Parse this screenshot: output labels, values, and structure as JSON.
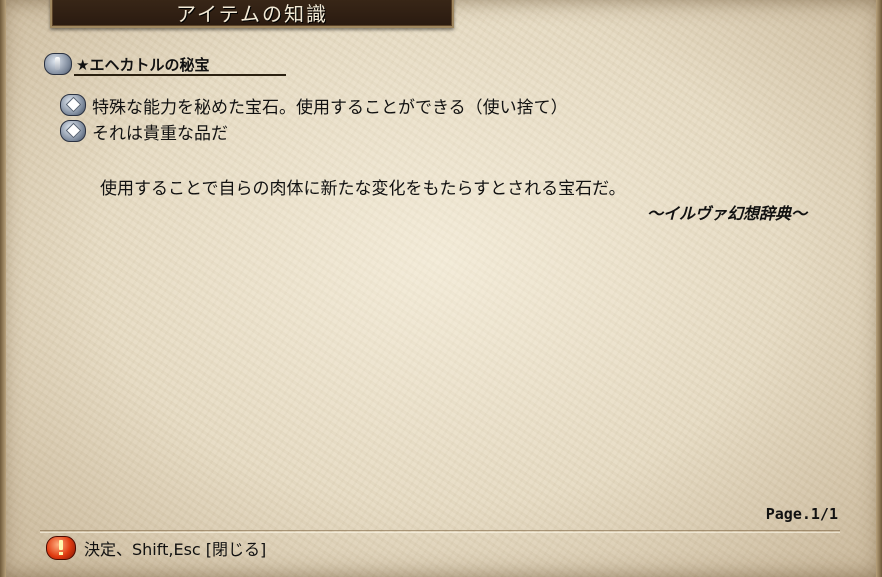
{
  "window": {
    "title": "アイテムの知識"
  },
  "item": {
    "name": "★エヘカトルの秘宝",
    "bullets": [
      "特殊な能力を秘めた宝石。使用することができる（使い捨て）",
      "それは貴重な品だ"
    ],
    "description": "使用することで自らの肉体に新たな変化をもたらすとされる宝石だ。",
    "source": "～イルヴァ幻想辞典～"
  },
  "pagination": {
    "label": "Page.1/1"
  },
  "footer": {
    "hint": "決定、Shift,Esc [閉じる]"
  },
  "icons": {
    "header": "item-category-icon",
    "bullet": "diamond-bullet-icon",
    "footer": "alert-icon"
  },
  "colors": {
    "parchment": "#e4d9c1",
    "banner": "#2a1a10",
    "text": "#111111",
    "alert": "#e03a10"
  }
}
